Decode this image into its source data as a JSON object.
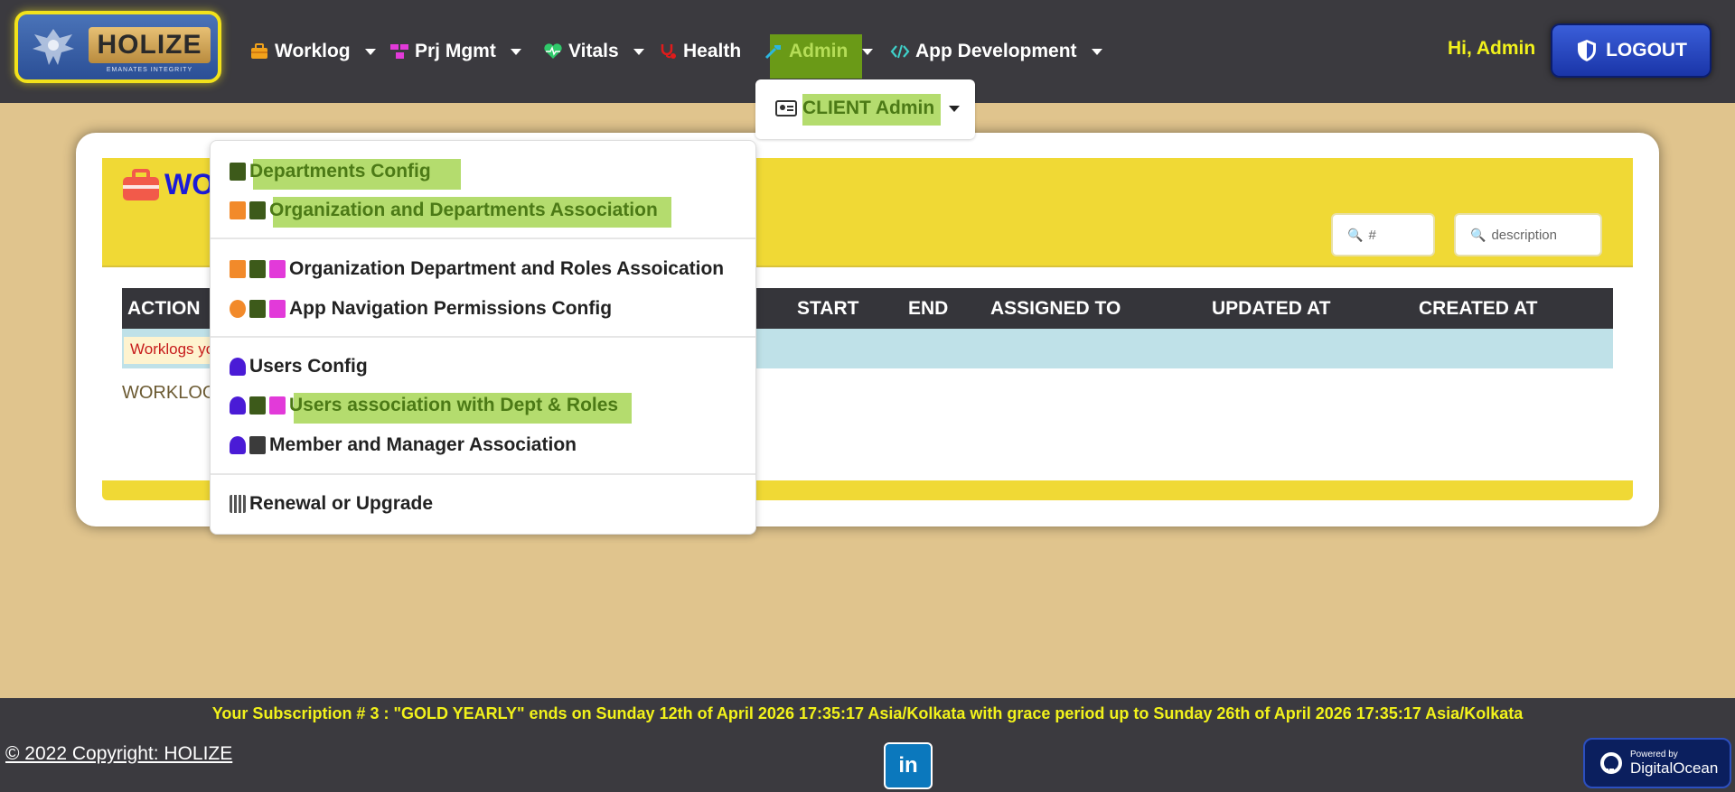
{
  "brand": {
    "name": "HOLIZE",
    "tagline": "EMANATES INTEGRITY"
  },
  "nav": {
    "worklog": "Worklog",
    "prj_mgmt": "Prj Mgmt",
    "vitals": "Vitals",
    "health": "Health",
    "admin": "Admin",
    "app_dev": "App Development"
  },
  "user": {
    "greeting": "Hi, Admin",
    "logout": "LOGOUT"
  },
  "client_admin": {
    "label": "CLIENT Admin"
  },
  "admin_menu": {
    "items": [
      "Departments Config",
      "Organization and Departments Association",
      "Organization Department and Roles Assoication",
      "App Navigation Permissions Config",
      "Users Config",
      "Users association with Dept & Roles",
      "Member and Manager Association",
      "Renewal or Upgrade"
    ]
  },
  "page": {
    "title_visible": "WO",
    "filter_id_placeholder": "#",
    "filter_desc_placeholder": "description",
    "columns": [
      "ACTION",
      "START",
      "END",
      "ASSIGNED TO",
      "UPDATED AT",
      "CREATED AT"
    ],
    "info_message": "Worklogs yo",
    "worklog_label": "WORKLOG"
  },
  "footer": {
    "subscription": "Your Subscription # 3 : \"GOLD YEARLY\" ends on Sunday 12th of April 2026 17:35:17 Asia/Kolkata with grace period up to Sunday 26th of April 2026 17:35:17 Asia/Kolkata",
    "copyright": "© 2022 Copyright: HOLIZE",
    "linkedin": "in",
    "do_small": "Powered by",
    "do_big": "DigitalOcean"
  },
  "colors": {
    "navbar_bg": "#3b3a3f",
    "page_bg": "#e0c48d",
    "accent_yellow": "#f0d935",
    "highlight_green": "#b4dc6e",
    "logout_blue": "#2a4bc6"
  },
  "icons": {
    "worklog": "briefcase-icon",
    "prj_mgmt": "project-icon",
    "vitals": "heartbeat-icon",
    "health": "stethoscope-icon",
    "admin": "tools-icon",
    "app_dev": "code-icon",
    "logout": "shield-icon",
    "client_admin": "id-card-icon"
  }
}
